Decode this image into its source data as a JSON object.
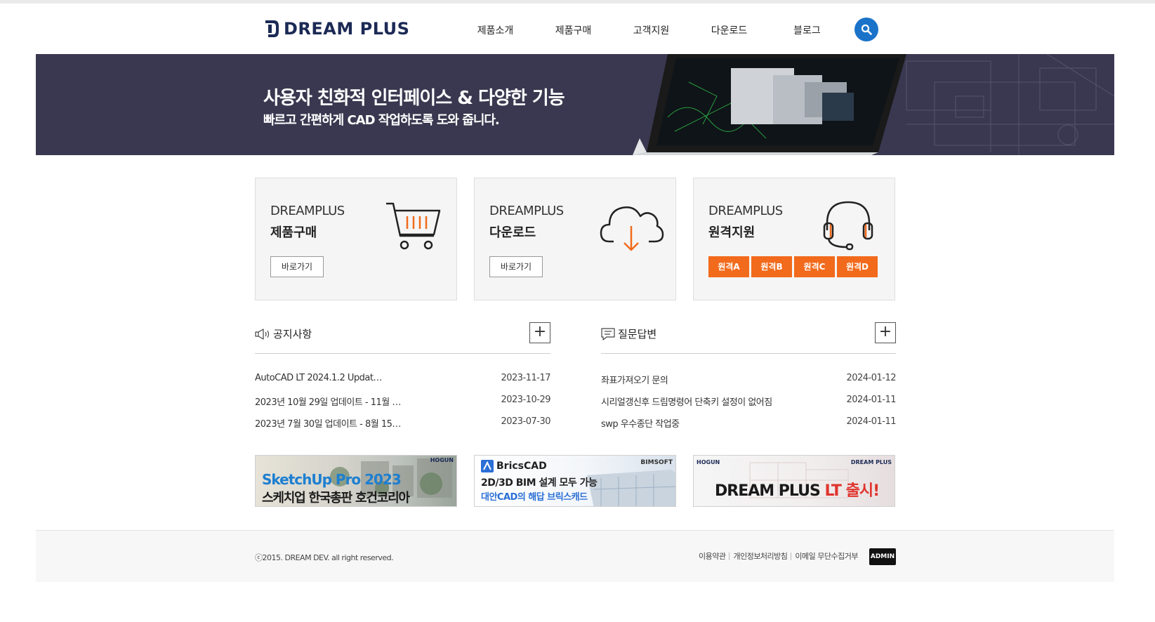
{
  "header": {
    "logo_text": "DREAM PLUS",
    "nav": [
      {
        "label": "제품소개"
      },
      {
        "label": "제품구매"
      },
      {
        "label": "고객지원"
      },
      {
        "label": "다운로드"
      },
      {
        "label": "블로그"
      }
    ],
    "search_icon": "search-icon"
  },
  "banner": {
    "title": "사용자 친화적 인터페이스 & 다양한 기능",
    "subtitle": "빠르고 간편하게 CAD 작업하도록 도와 줍니다."
  },
  "cards": [
    {
      "brand": "DREAMPLUS",
      "title": "제품구매",
      "button": "바로가기",
      "icon": "cart-icon"
    },
    {
      "brand": "DREAMPLUS",
      "title": "다운로드",
      "button": "바로가기",
      "icon": "cloud-download-icon"
    },
    {
      "brand": "DREAMPLUS",
      "title": "원격지원",
      "icon": "headset-icon",
      "remote_buttons": [
        "원격A",
        "원격B",
        "원격C",
        "원격D"
      ]
    }
  ],
  "notice": {
    "title": "공지사항",
    "items": [
      {
        "title": "AutoCAD LT 2024.1.2 Updat…",
        "date": "2023-11-17"
      },
      {
        "title": "2023년 10월 29일 업데이트 - 11월 …",
        "date": "2023-10-29"
      },
      {
        "title": "2023년 7월 30일 업데이트 - 8월 15…",
        "date": "2023-07-30"
      }
    ]
  },
  "qna": {
    "title": "질문답변",
    "items": [
      {
        "title": "좌표가져오기 문의",
        "date": "2024-01-12"
      },
      {
        "title": "시리얼갱신후 드림명령어 단축키 설정이 없어짐",
        "date": "2024-01-11"
      },
      {
        "title": "swp 우수종단 작업중",
        "date": "2024-01-11"
      }
    ]
  },
  "promos": [
    {
      "line1": "SketchUp Pro 2023",
      "line2": "스케치업 한국총판 호건코리아",
      "badge": "HOGUN"
    },
    {
      "brand": "BricsCAD",
      "badge": "BIMSOFT",
      "line1": "2D/3D BIM 설계 모두 가능",
      "line2": "대안CAD의 해답 브릭스캐드"
    },
    {
      "badge_left": "HOGUN",
      "badge_right": "DREAM PLUS",
      "line1a": "DREAM PLUS ",
      "line1b": "LT 출시!"
    }
  ],
  "footer": {
    "copyright": "ⓒ2015. DREAM DEV. all right reserved.",
    "links": [
      "이용약관",
      "개인정보처리방침",
      "이메일 무단수집거부"
    ],
    "admin": "ADMIN"
  },
  "colors": {
    "accent_orange": "#f26a1b",
    "brand_navy": "#1b2a55",
    "search_blue": "#1a73c9",
    "banner_bg": "#3a3850"
  }
}
